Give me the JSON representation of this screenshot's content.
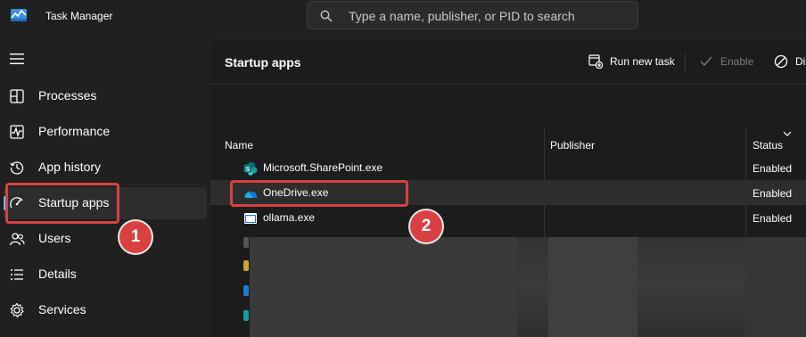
{
  "window": {
    "title": "Task Manager"
  },
  "search": {
    "placeholder": "Type a name, publisher, or PID to search"
  },
  "sidebar": {
    "items": [
      {
        "label": "Processes",
        "icon": "processes-icon"
      },
      {
        "label": "Performance",
        "icon": "performance-icon"
      },
      {
        "label": "App history",
        "icon": "app-history-icon"
      },
      {
        "label": "Startup apps",
        "icon": "startup-apps-icon",
        "selected": true
      },
      {
        "label": "Users",
        "icon": "users-icon"
      },
      {
        "label": "Details",
        "icon": "details-icon"
      },
      {
        "label": "Services",
        "icon": "services-icon"
      }
    ]
  },
  "main": {
    "title": "Startup apps",
    "toolbar": {
      "run_new_task": "Run new task",
      "enable": "Enable",
      "disable": "Di"
    },
    "columns": {
      "name": "Name",
      "publisher": "Publisher",
      "status": "Status"
    },
    "rows": [
      {
        "name": "Microsoft.SharePoint.exe",
        "publisher": "",
        "status": "Enabled",
        "icon": "sharepoint-icon"
      },
      {
        "name": "OneDrive.exe",
        "publisher": "",
        "status": "Enabled",
        "icon": "onedrive-icon"
      },
      {
        "name": "ollama.exe",
        "publisher": "",
        "status": "Enabled",
        "icon": "ollama-icon"
      }
    ]
  },
  "annotations": {
    "badge_1": "1",
    "badge_2": "2"
  },
  "colors": {
    "accent": "#76b9ed",
    "callout": "#d94042",
    "background": "#202020",
    "panel": "#1c1c1c"
  }
}
